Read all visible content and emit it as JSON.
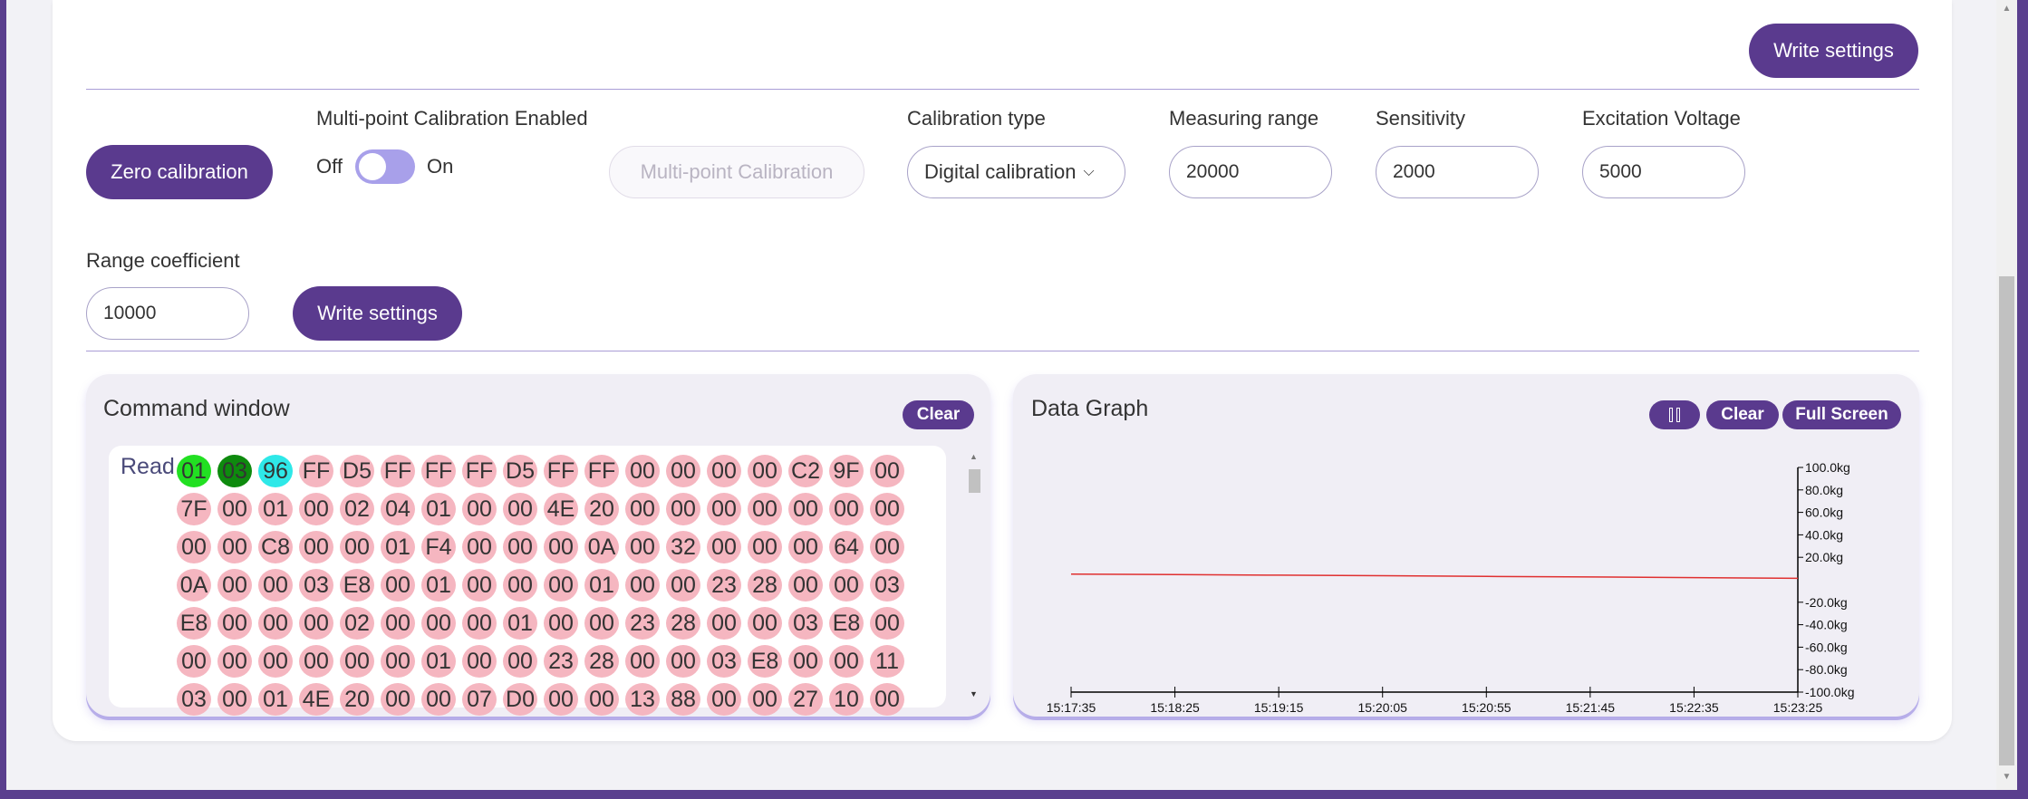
{
  "top": {
    "write_settings_label": "Write settings"
  },
  "calibration": {
    "zero_calibration_label": "Zero calibration",
    "multipoint_enabled_label": "Multi-point Calibration Enabled",
    "toggle_off_label": "Off",
    "toggle_on_label": "On",
    "toggle_state": "off",
    "multipoint_button_label": "Multi-point Calibration",
    "calibration_type_label": "Calibration type",
    "calibration_type_value": "Digital calibration",
    "measuring_range_label": "Measuring range",
    "measuring_range_value": "20000",
    "sensitivity_label": "Sensitivity",
    "sensitivity_value": "2000",
    "excitation_voltage_label": "Excitation Voltage",
    "excitation_voltage_value": "5000",
    "range_coefficient_label": "Range coefficient",
    "range_coefficient_value": "10000",
    "write_settings_label": "Write settings"
  },
  "command_window": {
    "title": "Command window",
    "clear_label": "Clear",
    "read_label": "Read",
    "rows": [
      [
        "01",
        "03",
        "96",
        "FF",
        "D5",
        "FF",
        "FF",
        "FF",
        "D5",
        "FF",
        "FF",
        "00",
        "00",
        "00",
        "00",
        "C2",
        "9F",
        "00"
      ],
      [
        "7F",
        "00",
        "01",
        "00",
        "02",
        "04",
        "01",
        "00",
        "00",
        "4E",
        "20",
        "00",
        "00",
        "00",
        "00",
        "00",
        "00",
        "00"
      ],
      [
        "00",
        "00",
        "C8",
        "00",
        "00",
        "01",
        "F4",
        "00",
        "00",
        "00",
        "0A",
        "00",
        "32",
        "00",
        "00",
        "00",
        "64",
        "00"
      ],
      [
        "0A",
        "00",
        "00",
        "03",
        "E8",
        "00",
        "01",
        "00",
        "00",
        "00",
        "01",
        "00",
        "00",
        "23",
        "28",
        "00",
        "00",
        "03"
      ],
      [
        "E8",
        "00",
        "00",
        "00",
        "02",
        "00",
        "00",
        "00",
        "01",
        "00",
        "00",
        "23",
        "28",
        "00",
        "00",
        "03",
        "E8",
        "00"
      ],
      [
        "00",
        "00",
        "00",
        "00",
        "00",
        "00",
        "01",
        "00",
        "00",
        "23",
        "28",
        "00",
        "00",
        "03",
        "E8",
        "00",
        "00",
        "11"
      ],
      [
        "03",
        "00",
        "01",
        "4E",
        "20",
        "00",
        "00",
        "07",
        "D0",
        "00",
        "00",
        "13",
        "88",
        "00",
        "00",
        "27",
        "10",
        "00"
      ]
    ],
    "highlight_colors": {
      "0": "#22e022",
      "1": "#0e8a0e",
      "2": "#2ee8e8"
    },
    "default_color": "#f5b6c0"
  },
  "data_graph": {
    "title": "Data Graph",
    "pause_icon": "pause-icon",
    "clear_label": "Clear",
    "fullscreen_label": "Full Screen"
  },
  "chart_data": {
    "type": "line",
    "x": [
      "15:17:35",
      "15:18:25",
      "15:19:15",
      "15:20:05",
      "15:20:55",
      "15:21:45",
      "15:22:35",
      "15:23:25"
    ],
    "series": [
      {
        "color": "#e03030",
        "values": [
          5.0,
          4.6,
          4.1,
          3.6,
          3.0,
          2.5,
          1.9,
          1.3
        ]
      }
    ],
    "y_ticks": [
      "100.0kg",
      "80.0kg",
      "60.0kg",
      "40.0kg",
      "20.0kg",
      "-20.0kg",
      "-40.0kg",
      "-60.0kg",
      "-80.0kg",
      "-100.0kg"
    ],
    "y_tick_values": [
      100,
      80,
      60,
      40,
      20,
      -20,
      -40,
      -60,
      -80,
      -100
    ],
    "ylim": [
      -100,
      100
    ],
    "xlabel": "",
    "ylabel": "",
    "grid": false
  }
}
